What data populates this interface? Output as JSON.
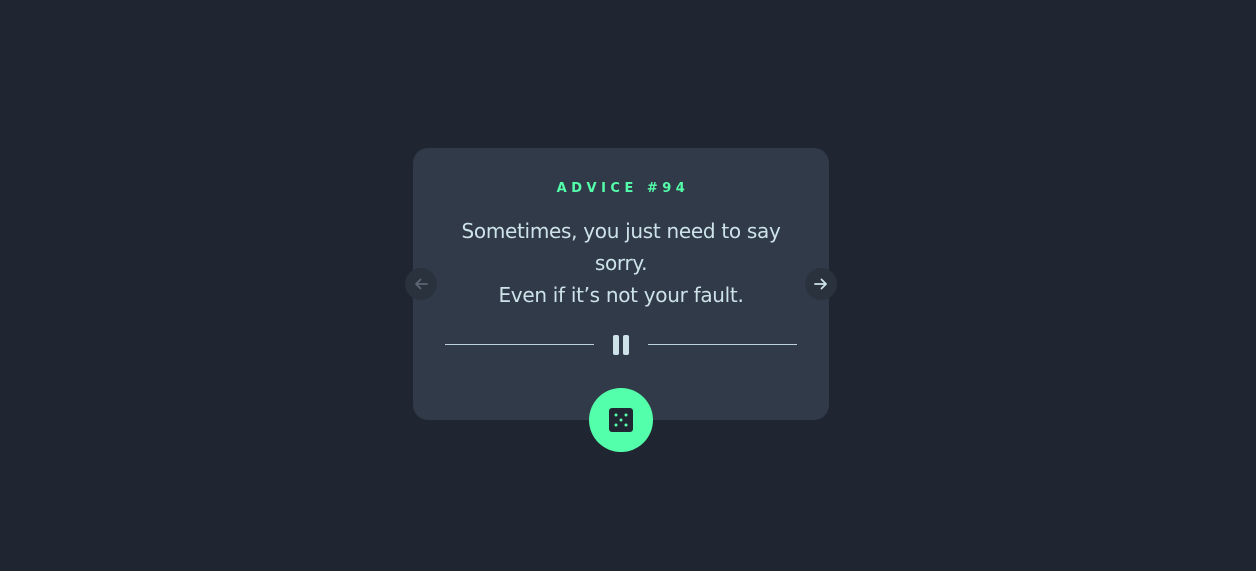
{
  "card": {
    "advice_label": "ADVICE #94",
    "quote_line1": "Sometimes, you just need to say sorry.",
    "quote_line2": "Even if it’s not your fault."
  },
  "controls": {
    "prev_icon": "arrow-left-icon",
    "next_icon": "arrow-right-icon",
    "pause_icon": "pause-icon",
    "dice_icon": "dice-icon"
  },
  "colors": {
    "background": "#1f2632",
    "card": "#313a48",
    "accent": "#53ffaa",
    "text": "#cee3e9"
  }
}
